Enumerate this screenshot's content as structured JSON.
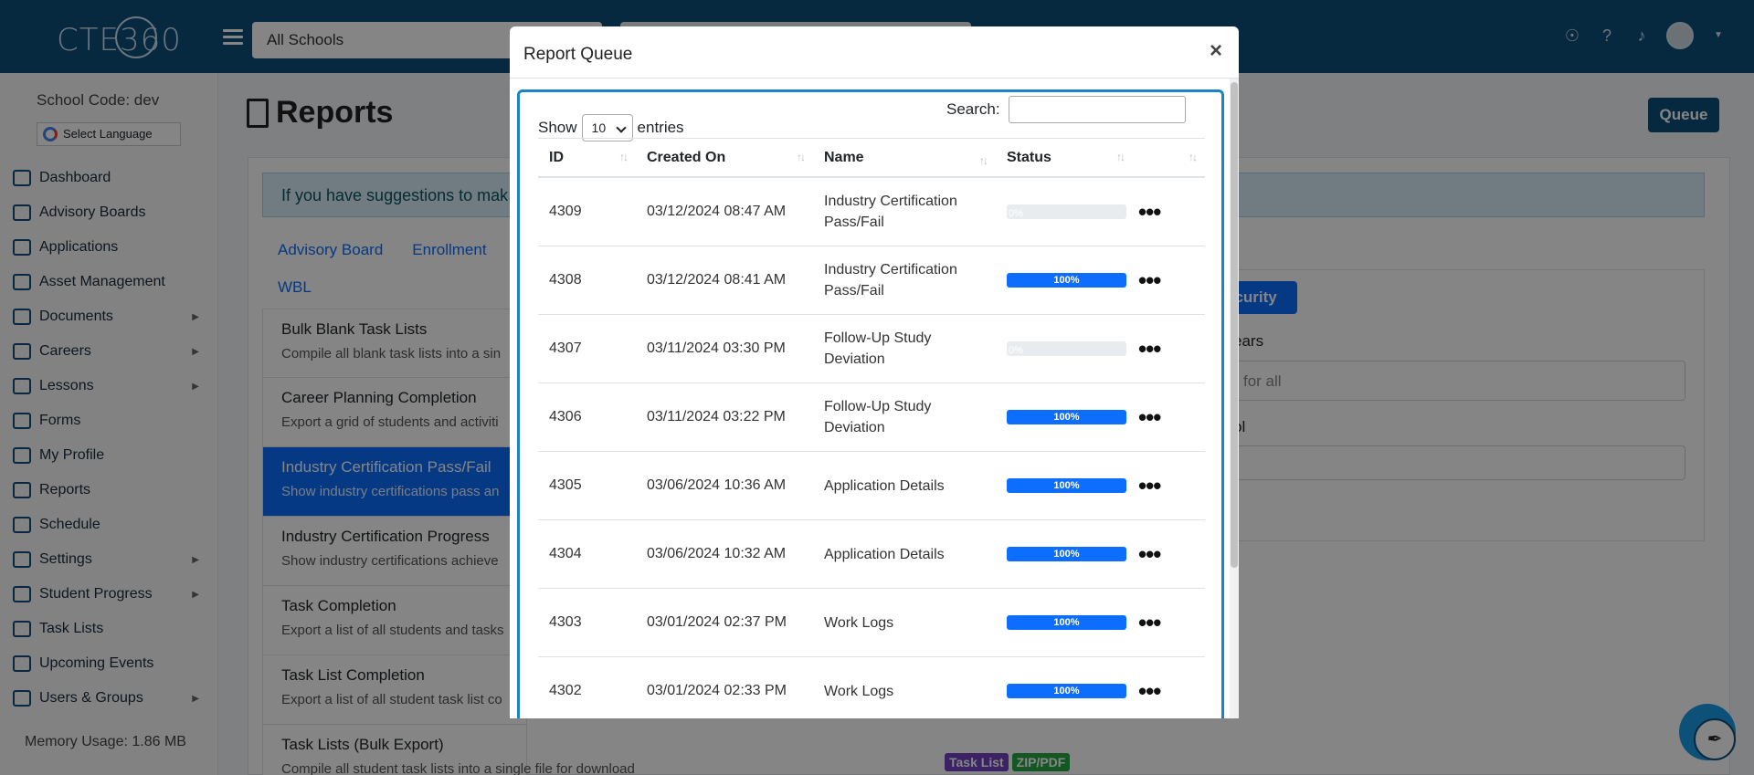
{
  "header": {
    "logo": "CTE360",
    "school_select": "All Schools"
  },
  "sidebar": {
    "school_code": "School Code: dev",
    "language": "Select Language",
    "items": [
      {
        "label": "Dashboard"
      },
      {
        "label": "Advisory Boards"
      },
      {
        "label": "Applications"
      },
      {
        "label": "Asset Management"
      },
      {
        "label": "Documents"
      },
      {
        "label": "Careers"
      },
      {
        "label": "Lessons"
      },
      {
        "label": "Forms"
      },
      {
        "label": "My Profile"
      },
      {
        "label": "Reports"
      },
      {
        "label": "Schedule"
      },
      {
        "label": "Settings"
      },
      {
        "label": "Student Progress"
      },
      {
        "label": "Task Lists"
      },
      {
        "label": "Upcoming Events"
      },
      {
        "label": "Users & Groups"
      }
    ],
    "memory": "Memory Usage: 1.86 MB"
  },
  "page": {
    "title": "Reports",
    "queue_button": "Queue",
    "info": "If you have suggestions to mak",
    "tabs": [
      "Advisory Board",
      "Enrollment"
    ],
    "tab_wbl": "WBL",
    "reports": [
      {
        "title": "Bulk Blank Task Lists",
        "desc": "Compile all blank task lists into a sin"
      },
      {
        "title": "Career Planning Completion",
        "desc": "Export a grid of students and activiti"
      },
      {
        "title": "Industry Certification Pass/Fail",
        "desc": "Show industry certifications pass an"
      },
      {
        "title": "Industry Certification Progress",
        "desc": "Show industry certifications achieve"
      },
      {
        "title": "Task Completion",
        "desc": "Export a list of all students and tasks"
      },
      {
        "title": "Task List Completion",
        "desc": "Export a list of all student task list co"
      },
      {
        "title": "Task Lists (Bulk Export)",
        "desc": "Compile all student task lists into a single file for download"
      }
    ],
    "badges": [
      "Task List",
      "ZIP/PDF"
    ],
    "right_card": {
      "security_button": "ecurity",
      "label1": "ears",
      "input_placeholder": "for all",
      "label2": "ol"
    }
  },
  "modal": {
    "title": "Report Queue",
    "close": "×",
    "show_label": "Show",
    "entries_value": "10",
    "entries_label": "entries",
    "search_label": "Search:",
    "columns": [
      "ID",
      "Created On",
      "Name",
      "Status"
    ],
    "rows": [
      {
        "id": "4309",
        "created": "03/12/2024 08:47 AM",
        "name": "Industry Certification Pass/Fail",
        "progress": 0,
        "label": "0%"
      },
      {
        "id": "4308",
        "created": "03/12/2024 08:41 AM",
        "name": "Industry Certification Pass/Fail",
        "progress": 100,
        "label": "100%"
      },
      {
        "id": "4307",
        "created": "03/11/2024 03:30 PM",
        "name": "Follow-Up Study Deviation",
        "progress": 0,
        "label": "0%"
      },
      {
        "id": "4306",
        "created": "03/11/2024 03:22 PM",
        "name": "Follow-Up Study Deviation",
        "progress": 100,
        "label": "100%"
      },
      {
        "id": "4305",
        "created": "03/06/2024 10:36 AM",
        "name": "Application Details",
        "progress": 100,
        "label": "100%"
      },
      {
        "id": "4304",
        "created": "03/06/2024 10:32 AM",
        "name": "Application Details",
        "progress": 100,
        "label": "100%"
      },
      {
        "id": "4303",
        "created": "03/01/2024 02:37 PM",
        "name": "Work Logs",
        "progress": 100,
        "label": "100%"
      },
      {
        "id": "4302",
        "created": "03/01/2024 02:33 PM",
        "name": "Work Logs",
        "progress": 100,
        "label": "100%"
      }
    ]
  },
  "colors": {
    "brand": "#0d4f7c",
    "primary": "#0d6efd",
    "badge_purple": "#6f42c1",
    "badge_green": "#28a745"
  },
  "icons": {
    "menu": "hamburger-icon",
    "lightbulb": "lightbulb-icon",
    "help": "help-icon",
    "bell": "bell-icon",
    "more": "more-dots-icon"
  }
}
